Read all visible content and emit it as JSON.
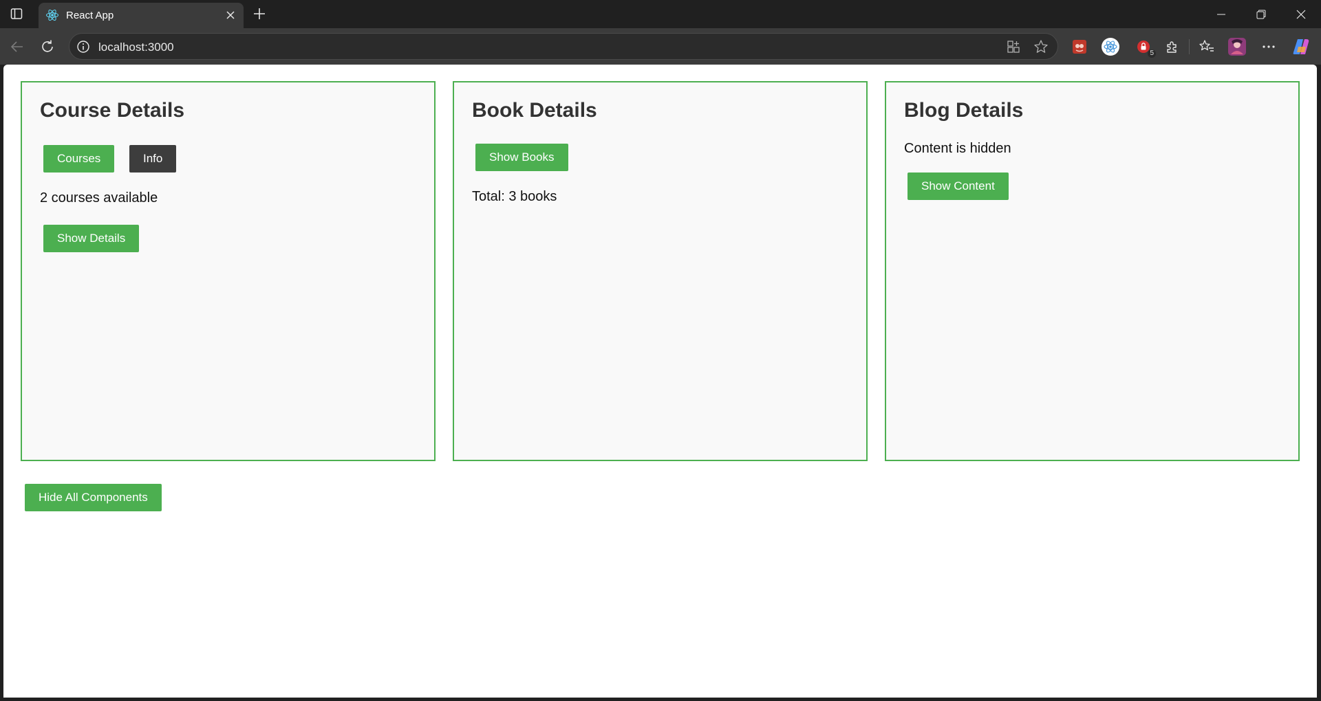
{
  "browser": {
    "tab_title": "React App",
    "url": "localhost:3000",
    "extension_badge": "5"
  },
  "course_card": {
    "title": "Course Details",
    "courses_button": "Courses",
    "info_button": "Info",
    "status_text": "2 courses available",
    "show_details_button": "Show Details"
  },
  "book_card": {
    "title": "Book Details",
    "show_books_button": "Show Books",
    "total_text": "Total: 3 books"
  },
  "blog_card": {
    "title": "Blog Details",
    "status_text": "Content is hidden",
    "show_content_button": "Show Content"
  },
  "page": {
    "hide_all_button": "Hide All Components"
  },
  "colors": {
    "accent_green": "#4caf50",
    "dark_button": "#3d3d3d",
    "card_background": "#f9f9f9"
  }
}
